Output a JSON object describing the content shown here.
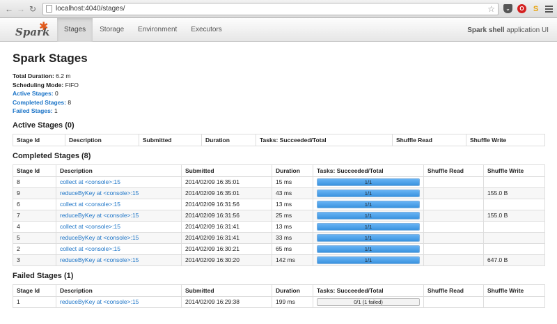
{
  "browser": {
    "url": "localhost:4040/stages/",
    "back_icon": "back-arrow-icon",
    "forward_icon": "forward-arrow-icon",
    "reload_icon": "reload-icon"
  },
  "navbar": {
    "logo_text": "Spark",
    "tabs": [
      {
        "label": "Stages",
        "active": true
      },
      {
        "label": "Storage",
        "active": false
      },
      {
        "label": "Environment",
        "active": false
      },
      {
        "label": "Executors",
        "active": false
      }
    ],
    "app_name": "Spark shell",
    "app_suffix": " application UI"
  },
  "page": {
    "title": "Spark Stages",
    "summary": {
      "total_duration_label": "Total Duration:",
      "total_duration_value": " 6.2 m",
      "scheduling_mode_label": "Scheduling Mode:",
      "scheduling_mode_value": " FIFO",
      "active_stages_label": "Active Stages:",
      "active_stages_value": " 0",
      "completed_stages_label": "Completed Stages:",
      "completed_stages_value": " 8",
      "failed_stages_label": "Failed Stages:",
      "failed_stages_value": " 1"
    }
  },
  "active": {
    "heading": "Active Stages (0)",
    "columns": [
      "Stage Id",
      "Description",
      "Submitted",
      "Duration",
      "Tasks: Succeeded/Total",
      "Shuffle Read",
      "Shuffle Write"
    ]
  },
  "completed": {
    "heading": "Completed Stages (8)",
    "columns": [
      "Stage Id",
      "Description",
      "Submitted",
      "Duration",
      "Tasks: Succeeded/Total",
      "Shuffle Read",
      "Shuffle Write"
    ],
    "rows": [
      {
        "id": "8",
        "desc": "collect at <console>:15",
        "submitted": "2014/02/09 16:35:01",
        "duration": "15 ms",
        "tasks": "1/1",
        "progress": 1,
        "read": "",
        "write": ""
      },
      {
        "id": "9",
        "desc": "reduceByKey at <console>:15",
        "submitted": "2014/02/09 16:35:01",
        "duration": "43 ms",
        "tasks": "1/1",
        "progress": 1,
        "read": "",
        "write": "155.0 B"
      },
      {
        "id": "6",
        "desc": "collect at <console>:15",
        "submitted": "2014/02/09 16:31:56",
        "duration": "13 ms",
        "tasks": "1/1",
        "progress": 1,
        "read": "",
        "write": ""
      },
      {
        "id": "7",
        "desc": "reduceByKey at <console>:15",
        "submitted": "2014/02/09 16:31:56",
        "duration": "25 ms",
        "tasks": "1/1",
        "progress": 1,
        "read": "",
        "write": "155.0 B"
      },
      {
        "id": "4",
        "desc": "collect at <console>:15",
        "submitted": "2014/02/09 16:31:41",
        "duration": "13 ms",
        "tasks": "1/1",
        "progress": 1,
        "read": "",
        "write": ""
      },
      {
        "id": "5",
        "desc": "reduceByKey at <console>:15",
        "submitted": "2014/02/09 16:31:41",
        "duration": "33 ms",
        "tasks": "1/1",
        "progress": 1,
        "read": "",
        "write": ""
      },
      {
        "id": "2",
        "desc": "collect at <console>:15",
        "submitted": "2014/02/09 16:30:21",
        "duration": "65 ms",
        "tasks": "1/1",
        "progress": 1,
        "read": "",
        "write": ""
      },
      {
        "id": "3",
        "desc": "reduceByKey at <console>:15",
        "submitted": "2014/02/09 16:30:20",
        "duration": "142 ms",
        "tasks": "1/1",
        "progress": 1,
        "read": "",
        "write": "647.0 B"
      }
    ]
  },
  "failed": {
    "heading": "Failed Stages (1)",
    "columns": [
      "Stage Id",
      "Description",
      "Submitted",
      "Duration",
      "Tasks: Succeeded/Total",
      "Shuffle Read",
      "Shuffle Write"
    ],
    "rows": [
      {
        "id": "1",
        "desc": "reduceByKey at <console>:15",
        "submitted": "2014/02/09 16:29:38",
        "duration": "199 ms",
        "tasks": "0/1 (1 failed)",
        "progress": 0,
        "read": "",
        "write": ""
      }
    ]
  }
}
